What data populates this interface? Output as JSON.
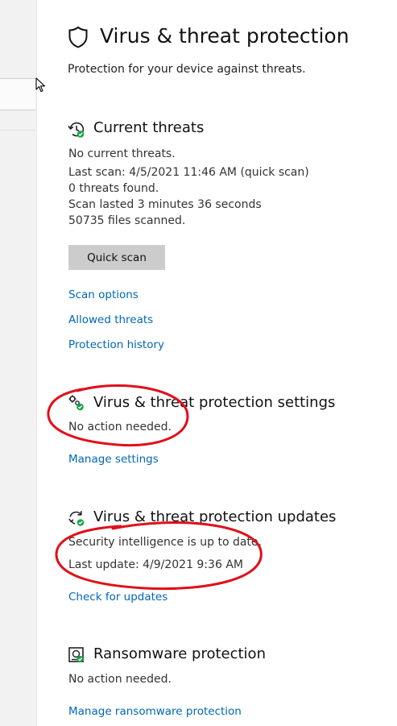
{
  "page": {
    "title": "Virus & threat protection",
    "subtitle": "Protection for your device against threats."
  },
  "current_threats": {
    "heading": "Current threats",
    "lines": [
      "No current threats.",
      "Last scan: 4/5/2021 11:46 AM (quick scan)",
      "0 threats found.",
      "Scan lasted 3 minutes 36 seconds",
      "50735 files scanned."
    ],
    "quick_scan_label": "Quick scan",
    "links": {
      "scan_options": "Scan options",
      "allowed_threats": "Allowed threats",
      "protection_history": "Protection history"
    }
  },
  "settings": {
    "heading": "Virus & threat protection settings",
    "status": "No action needed.",
    "link": "Manage settings"
  },
  "updates": {
    "heading": "Virus & threat protection updates",
    "status": "Security intelligence is up to date.",
    "last_update": "Last update: 4/9/2021 9:36 AM",
    "link": "Check for updates"
  },
  "ransomware": {
    "heading": "Ransomware protection",
    "status": "No action needed.",
    "link": "Manage ransomware protection"
  },
  "colors": {
    "link": "#0067b8",
    "ok_badge": "#16a34a",
    "annotation": "#e0101b",
    "button": "#cccccc"
  },
  "icons": {
    "title": "shield-icon",
    "current_threats": "history-check-icon",
    "settings": "gears-check-icon",
    "updates": "refresh-check-icon",
    "ransomware": "ransomware-icon"
  }
}
